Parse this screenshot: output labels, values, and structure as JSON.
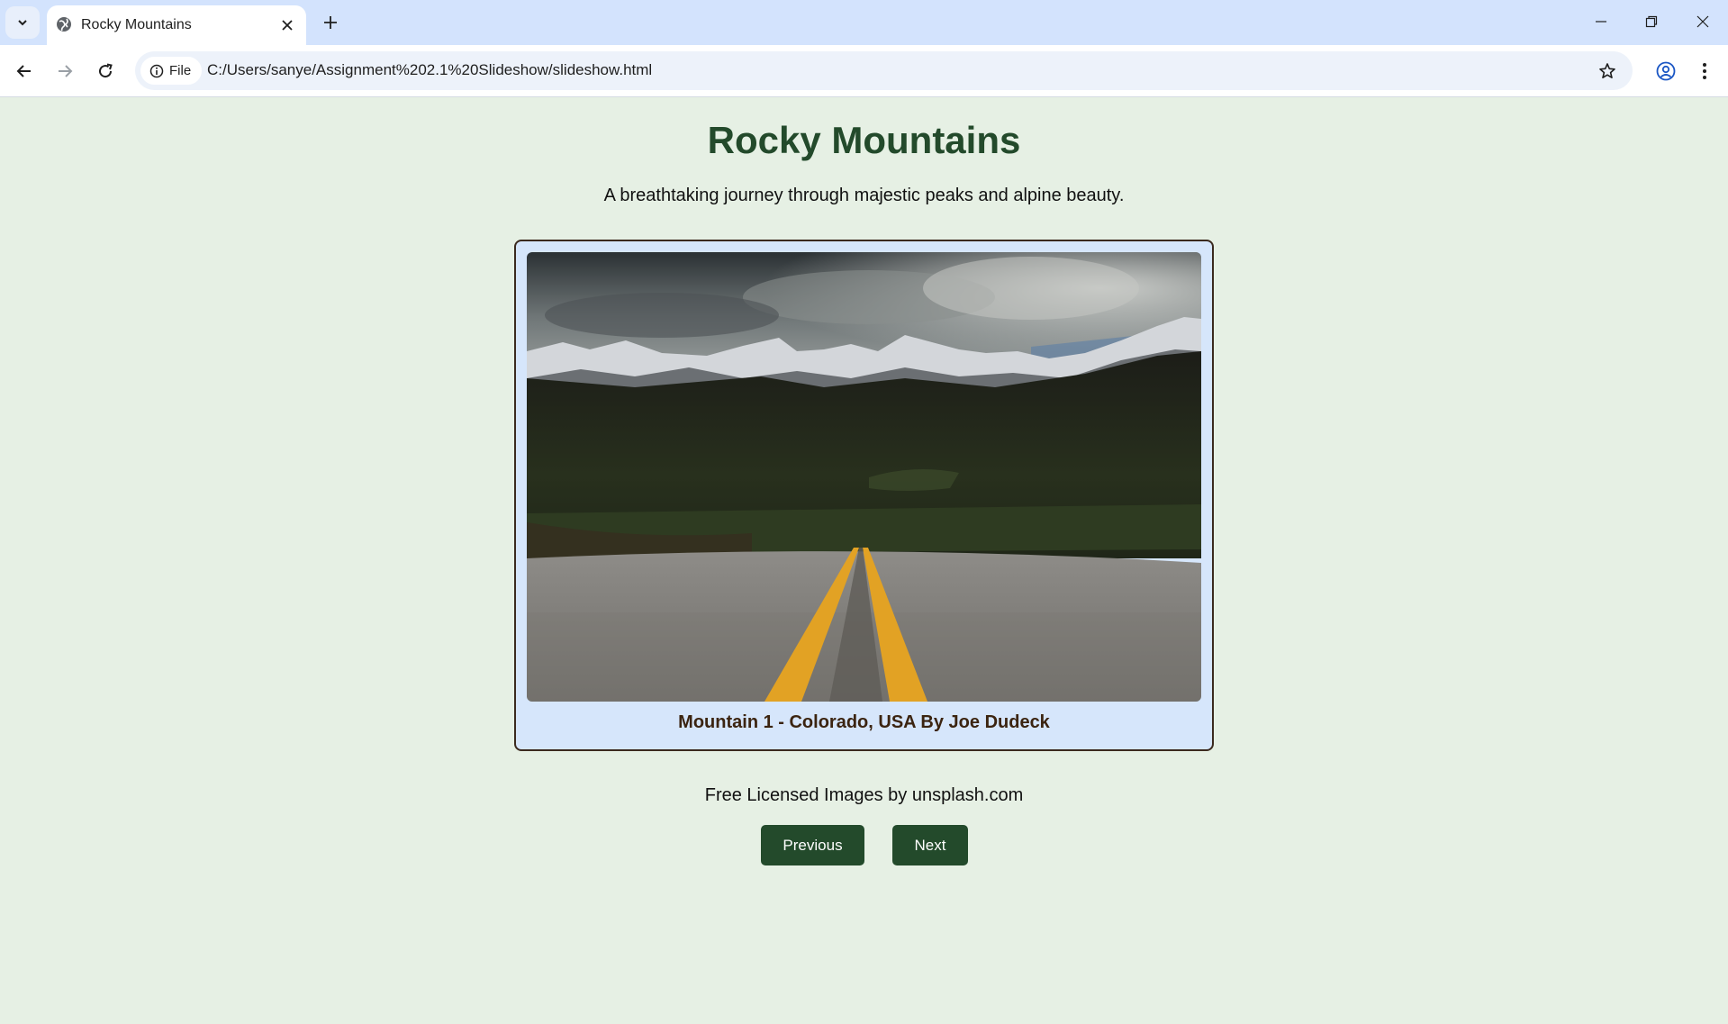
{
  "browser": {
    "tab_title": "Rocky Mountains",
    "chip_label": "File",
    "url": "C:/Users/sanye/Assignment%202.1%20Slideshow/slideshow.html"
  },
  "page": {
    "title": "Rocky Mountains",
    "subtitle": "A breathtaking journey through majestic peaks and alpine beauty.",
    "caption": "Mountain 1 - Colorado, USA By Joe Dudeck",
    "credit": "Free Licensed Images by unsplash.com",
    "prev_label": "Previous",
    "next_label": "Next"
  },
  "colors": {
    "page_bg": "#e6f0e4",
    "accent": "#234a2b",
    "frame_bg": "#d6e6fb",
    "caption": "#3b2410"
  }
}
